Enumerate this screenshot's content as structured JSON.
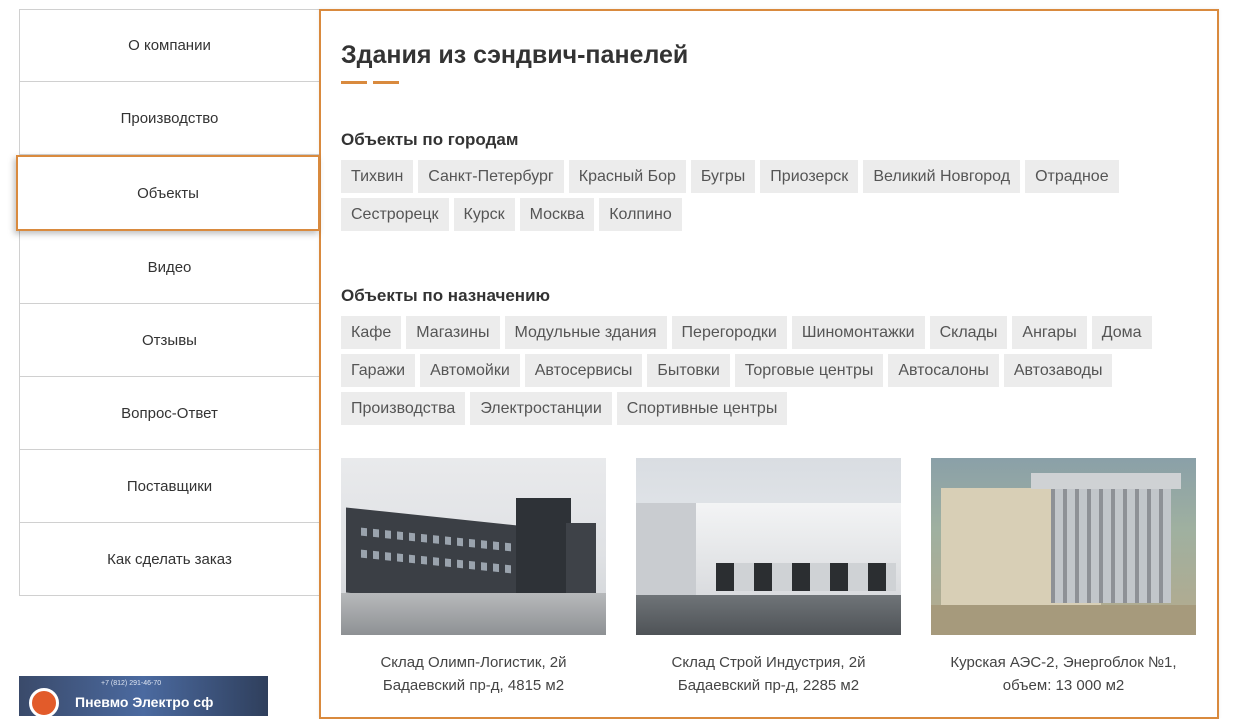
{
  "sidebar": {
    "items": [
      {
        "label": "О компании",
        "active": false
      },
      {
        "label": "Производство",
        "active": false
      },
      {
        "label": "Объекты",
        "active": true
      },
      {
        "label": "Видео",
        "active": false
      },
      {
        "label": "Отзывы",
        "active": false
      },
      {
        "label": "Вопрос-Ответ",
        "active": false
      },
      {
        "label": "Поставщики",
        "active": false
      },
      {
        "label": "Как сделать заказ",
        "active": false
      }
    ]
  },
  "banner": {
    "title": "Пневмо Электро сф",
    "phone": "+7 (812) 291-46-70"
  },
  "main": {
    "title": "Здания из сэндвич-панелей",
    "cities_title": "Объекты по городам",
    "cities": [
      "Тихвин",
      "Санкт-Петербург",
      "Красный Бор",
      "Бугры",
      "Приозерск",
      "Великий Новгород",
      "Отрадное",
      "Сестрорецк",
      "Курск",
      "Москва",
      "Колпино"
    ],
    "purpose_title": "Объекты по назначению",
    "purposes": [
      "Кафе",
      "Магазины",
      "Модульные здания",
      "Перегородки",
      "Шиномонтажки",
      "Склады",
      "Ангары",
      "Дома",
      "Гаражи",
      "Автомойки",
      "Автосервисы",
      "Бытовки",
      "Торговые центры",
      "Автосалоны",
      "Автозаводы",
      "Производства",
      "Электростанции",
      "Спортивные центры"
    ],
    "cards": [
      {
        "line1": "Склад Олимп-Логистик, 2й",
        "line2": "Бадаевский пр-д, 4815 м2"
      },
      {
        "line1": "Склад Строй Индустрия, 2й",
        "line2": "Бадаевский пр-д, 2285 м2"
      },
      {
        "line1": "Курская АЭС-2, Энергоблок №1,",
        "line2": "объем: 13 000 м2"
      }
    ]
  },
  "colors": {
    "accent": "#d98a3e",
    "tag_bg": "#ececec"
  }
}
